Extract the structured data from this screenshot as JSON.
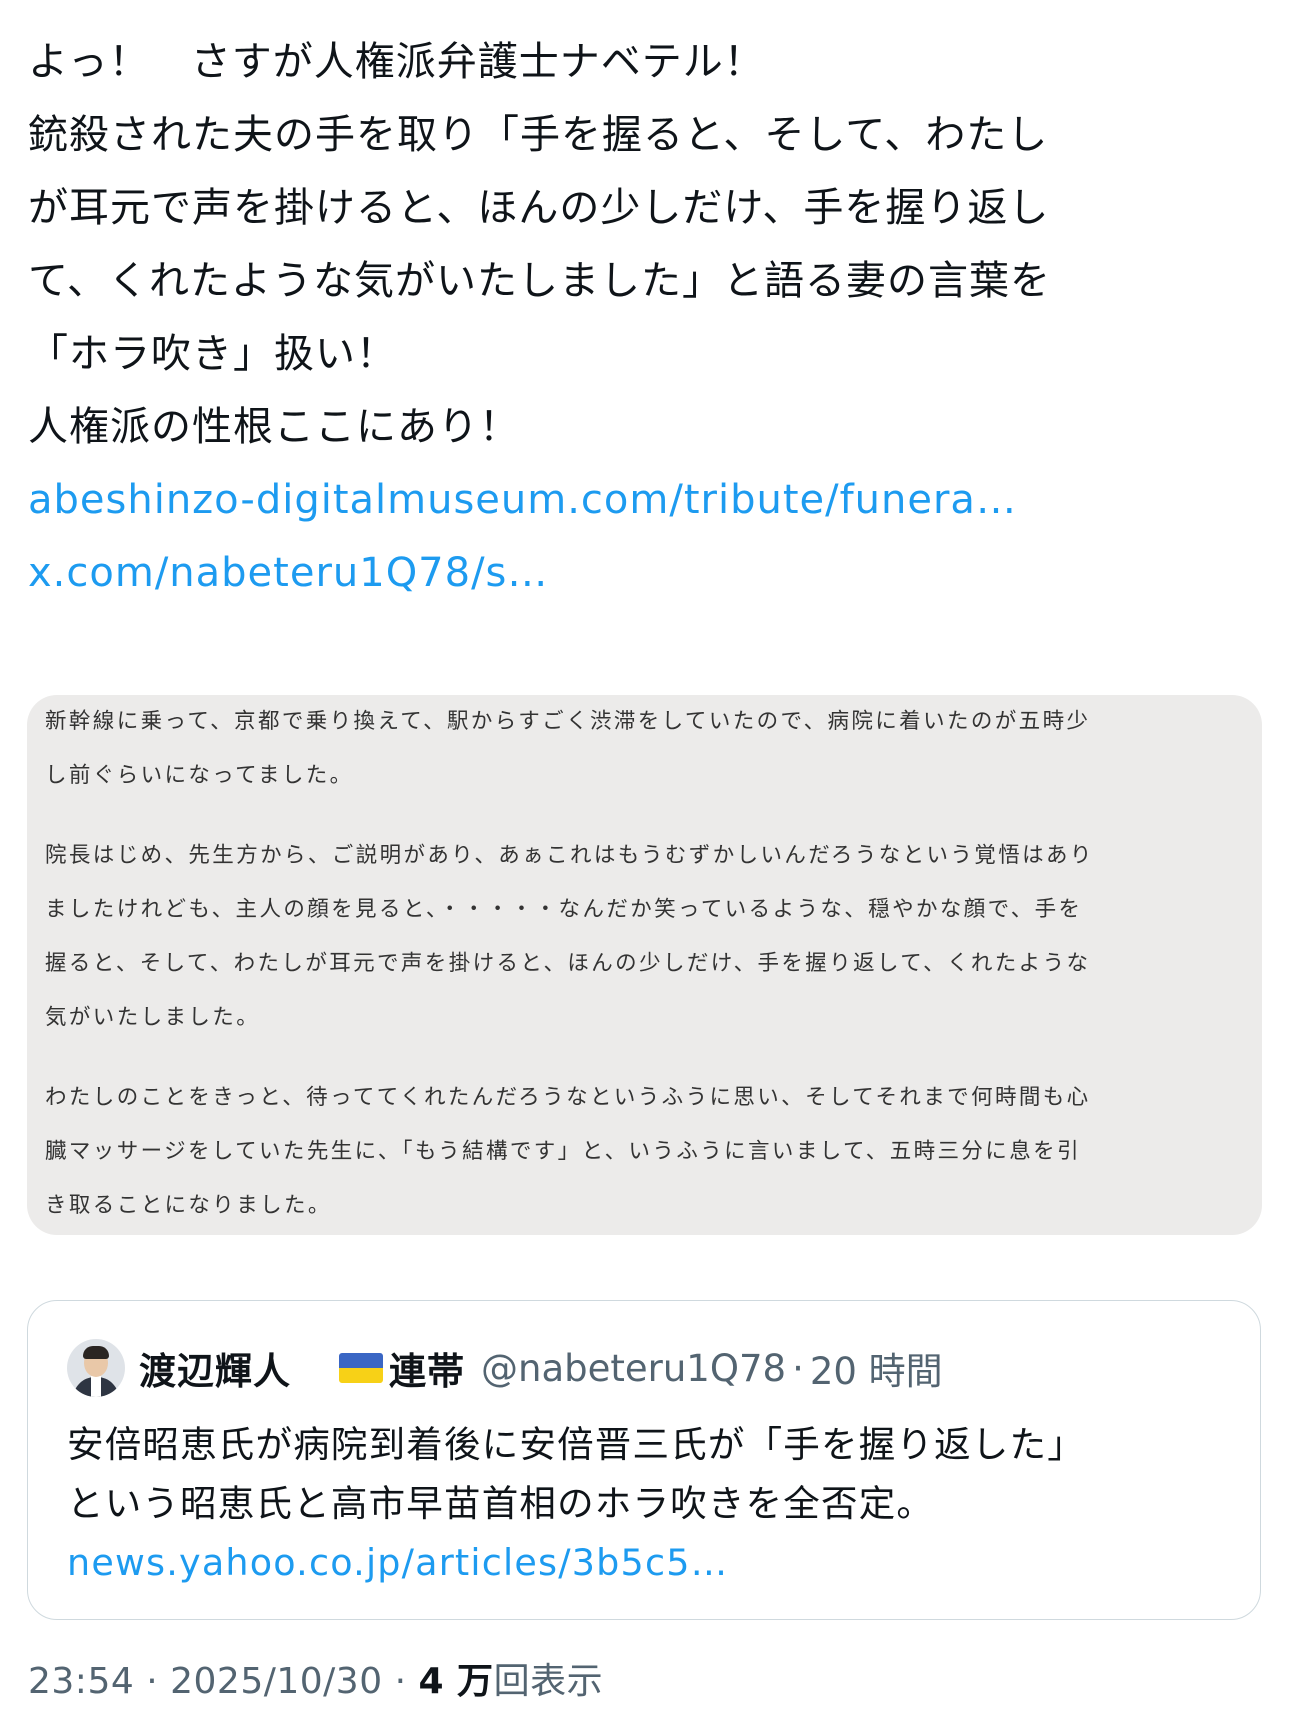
{
  "tweet": {
    "lines": [
      "よっ！　さすが人権派弁護士ナベテル！",
      "銃殺された夫の手を取り「手を握ると、そして、わたし",
      "が耳元で声を掛けると、ほんの少しだけ、手を握り返し",
      "て、くれたような気がいたしました」と語る妻の言葉を",
      "「ホラ吹き」扱い！",
      "人権派の性根ここにあり！"
    ],
    "links": [
      "abeshinzo-digitalmuseum.com/tribute/funera…",
      "x.com/nabeteru1Q78/s…"
    ]
  },
  "media_card": {
    "paragraphs": [
      [
        "新幹線に乗って、京都で乗り換えて、駅からすごく渋滞をしていたので、病院に着いたのが五時少",
        "し前ぐらいになってました。"
      ],
      [
        "院長はじめ、先生方から、ご説明があり、あぁこれはもうむずかしいんだろうなという覚悟はあり",
        "ましたけれども、主人の顔を見ると、・・・・・なんだか笑っているような、穏やかな顔で、手を",
        "握ると、そして、わたしが耳元で声を掛けると、ほんの少しだけ、手を握り返して、くれたような",
        "気がいたしました。"
      ],
      [
        "わたしのことをきっと、待っててくれたんだろうなというふうに思い、そしてそれまで何時間も心",
        "臓マッサージをしていた先生に、「もう結構です」と、いうふうに言いまして、五時三分に息を引",
        "き取ることになりました。"
      ]
    ]
  },
  "quote": {
    "author_name": "渡辺輝人",
    "flag_colors": {
      "top": "#3a66c4",
      "bottom": "#f7d117"
    },
    "author_tag": "連帯",
    "handle": "@nabeteru1Q78",
    "separator": "·",
    "time_ago": "20 時間",
    "lines": [
      "安倍昭恵氏が病院到着後に安倍晋三氏が「手を握り返した」",
      "という昭恵氏と高市早苗首相のホラ吹きを全否定。"
    ],
    "link": "news.yahoo.co.jp/articles/3b5c5…"
  },
  "footer": {
    "time": "23:54",
    "sep": "·",
    "date": "2025/10/30",
    "views_count": "4 万",
    "views_label": "回表示"
  }
}
